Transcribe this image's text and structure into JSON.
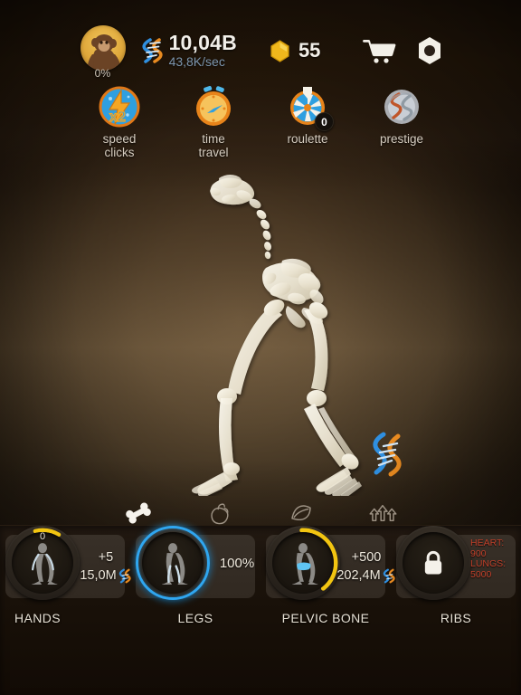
{
  "theme": {
    "accent_blue": "#2fa6f0",
    "accent_yellow": "#f2c511",
    "locked_red": "#c0402a",
    "text_light": "#efe9dd",
    "rate_blue": "#7c95ad"
  },
  "hud": {
    "evolution": {
      "name": "evolution-avatar",
      "percent": "0%",
      "creature": "ape"
    },
    "dna": {
      "icon": "dna-icon",
      "amount": "10,04B",
      "rate": "43,8K/sec"
    },
    "gems": {
      "icon": "gem-icon",
      "amount": "55"
    },
    "shop": {
      "icon": "shopping-cart-icon"
    },
    "settings": {
      "icon": "hex-nut-icon"
    }
  },
  "powerups": [
    {
      "id": "speed-clicks",
      "label": "speed\nclicks",
      "label_line1": "speed",
      "label_line2": "clicks",
      "icon": "speed-clicks-icon",
      "multiplier": "x2",
      "badge": null
    },
    {
      "id": "time-travel",
      "label": "time\ntravel",
      "label_line1": "time",
      "label_line2": "travel",
      "icon": "time-travel-icon",
      "badge": null
    },
    {
      "id": "roulette",
      "label": "roulette",
      "label_line1": "roulette",
      "label_line2": "",
      "icon": "roulette-icon",
      "badge": "0"
    },
    {
      "id": "prestige",
      "label": "prestige",
      "label_line1": "prestige",
      "label_line2": "",
      "icon": "prestige-icon",
      "badge": null
    }
  ],
  "stage": {
    "creature": "partial-skeleton",
    "floating_dna_icon": "dna-icon"
  },
  "tabs": [
    {
      "id": "bones",
      "icon": "bone-icon",
      "active": true
    },
    {
      "id": "organs",
      "icon": "organ-icon",
      "active": false
    },
    {
      "id": "muscles",
      "icon": "muscle-icon",
      "active": false
    },
    {
      "id": "upgrades",
      "icon": "upgrade-arrows-icon",
      "active": false
    }
  ],
  "body_parts": [
    {
      "id": "hands",
      "name": "HANDS",
      "level": "0",
      "gain": "+5",
      "cost": "15,0M",
      "cost_currency_icon": "dna-icon",
      "progress_pct": 12,
      "state": "upgradable",
      "ring_color": "#f2c511"
    },
    {
      "id": "legs",
      "name": "LEGS",
      "percent": "100%",
      "progress_pct": 100,
      "state": "complete",
      "ring_color": "#2fa6f0"
    },
    {
      "id": "pelvic-bone",
      "name": "PELVIC BONE",
      "gain": "+500",
      "cost": "202,4M",
      "cost_currency_icon": "dna-icon",
      "progress_pct": 40,
      "state": "upgradable",
      "ring_color": "#f2c511"
    },
    {
      "id": "ribs",
      "name": "RIBS",
      "state": "locked",
      "lock_icon": "padlock-icon",
      "requirements": [
        {
          "label": "HEART:",
          "value": "900"
        },
        {
          "label": "LUNGS:",
          "value": "5000"
        }
      ]
    }
  ]
}
